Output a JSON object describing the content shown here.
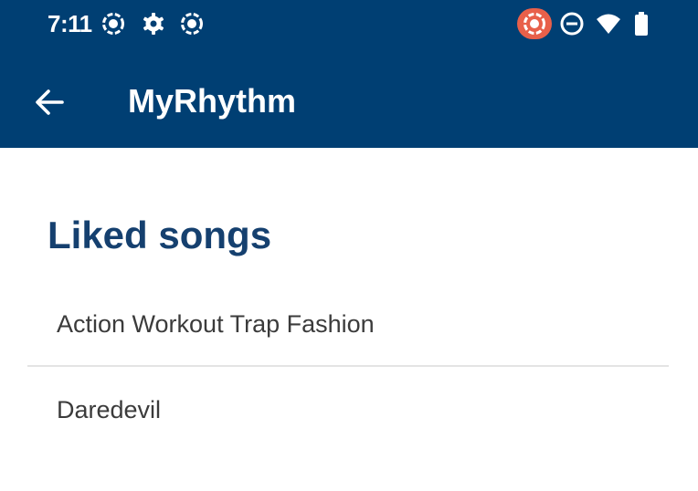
{
  "status_bar": {
    "time": "7:11",
    "left_icons": [
      "screen-record-icon",
      "settings-gear-icon",
      "screen-record-icon"
    ],
    "right_icons": [
      "cast-icon",
      "do-not-disturb-icon",
      "wifi-icon",
      "battery-icon"
    ],
    "cast_pill_color": "#e8604a"
  },
  "app_bar": {
    "title": "MyRhythm",
    "back_icon": "arrow-back-icon",
    "background_color": "#003f73"
  },
  "main": {
    "section_title": "Liked songs",
    "section_title_color": "#15406f",
    "songs": [
      {
        "label": "Action Workout Trap Fashion"
      },
      {
        "label": "Daredevil"
      }
    ]
  }
}
